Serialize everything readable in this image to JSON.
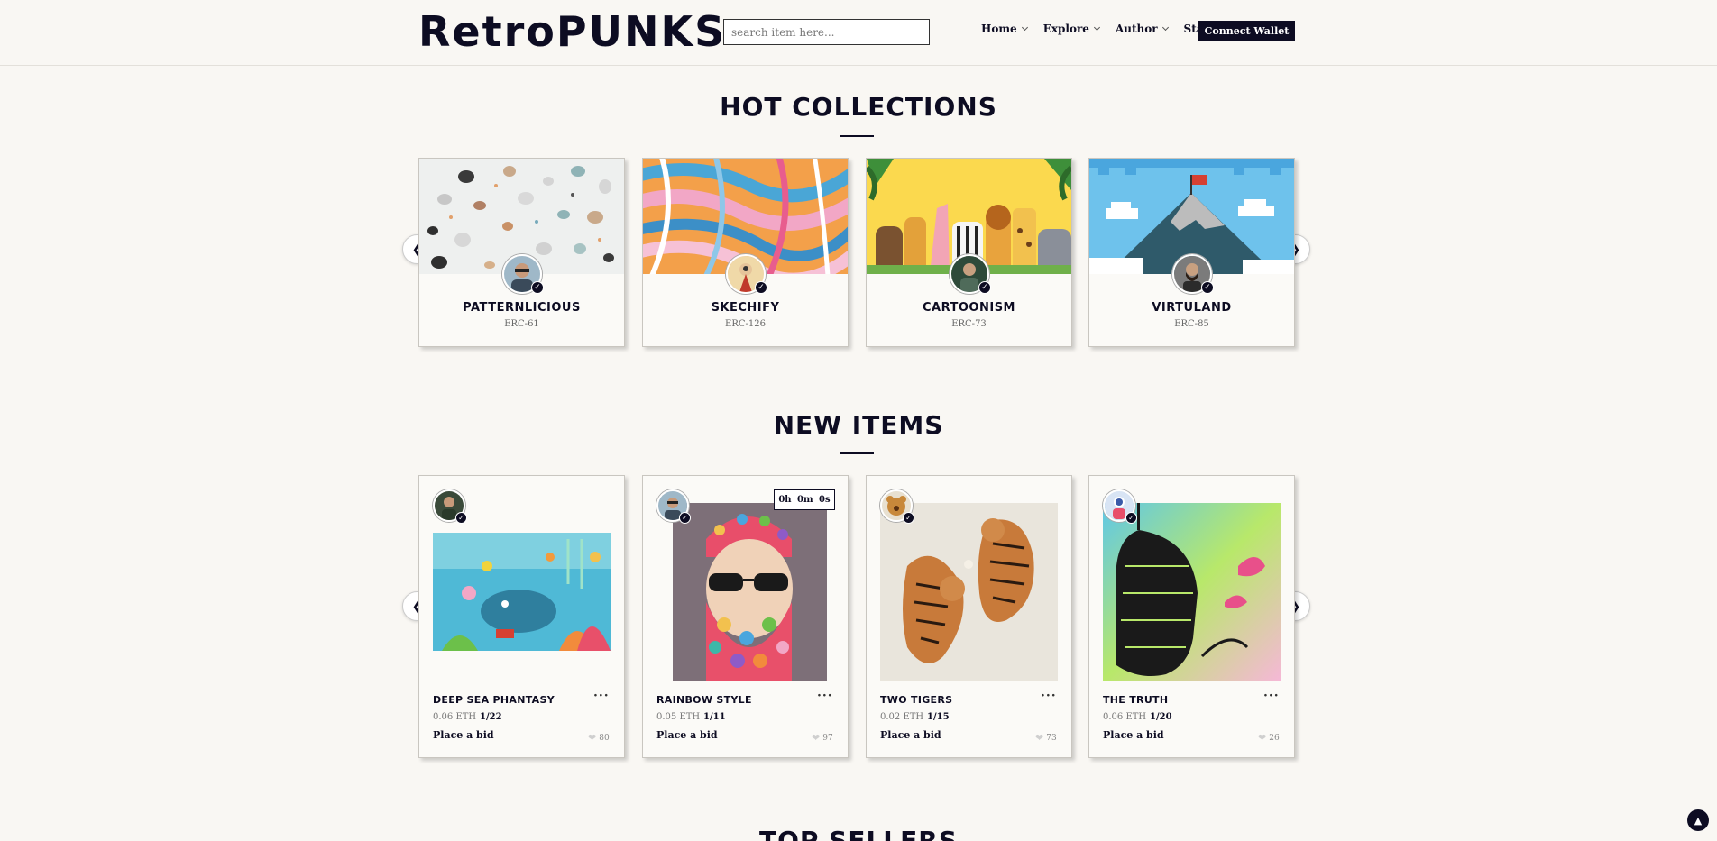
{
  "header": {
    "logo": "RetroPUNKS",
    "search_placeholder": "search item here...",
    "nav": [
      "Home",
      "Explore",
      "Author",
      "Stats"
    ],
    "wallet_label": "Connect Wallet"
  },
  "hot_collections": {
    "title": "HOT COLLECTIONS",
    "items": [
      {
        "name": "PATTERNLICIOUS",
        "erc": "ERC-61"
      },
      {
        "name": "SKECHIFY",
        "erc": "ERC-126"
      },
      {
        "name": "CARTOONISM",
        "erc": "ERC-73"
      },
      {
        "name": "VIRTULAND",
        "erc": "ERC-85"
      }
    ]
  },
  "new_items": {
    "title": "NEW ITEMS",
    "items": [
      {
        "name": "DEEP SEA PHANTASY",
        "price": "0.06 ETH",
        "edition": "1/22",
        "bid": "Place a bid",
        "likes": "80"
      },
      {
        "name": "RAINBOW STYLE",
        "price": "0.05 ETH",
        "edition": "1/11",
        "bid": "Place a bid",
        "likes": "97",
        "timer": "0h 0m 0s"
      },
      {
        "name": "TWO TIGERS",
        "price": "0.02 ETH",
        "edition": "1/15",
        "bid": "Place a bid",
        "likes": "73"
      },
      {
        "name": "THE TRUTH",
        "price": "0.06 ETH",
        "edition": "1/20",
        "bid": "Place a bid",
        "likes": "26"
      }
    ]
  },
  "next_section_title": "TOP SELLERS",
  "icons": {
    "prev": "chevron-left-icon",
    "next": "chevron-right-icon",
    "verified": "check-icon",
    "like": "heart-icon",
    "more": "more-dots-icon",
    "scroll_top": "chevron-up-icon"
  },
  "colors": {
    "primary": "#0d0c22",
    "background": "#f9f7f3"
  }
}
